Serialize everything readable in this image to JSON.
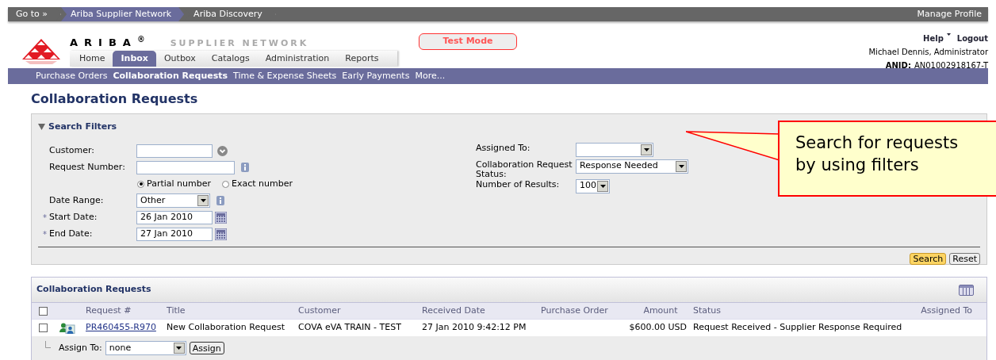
{
  "top_bar": {
    "links": [
      {
        "label": "Go to »",
        "selected": false
      },
      {
        "label": "Ariba Supplier Network",
        "selected": true
      },
      {
        "label": "Ariba Discovery",
        "selected": false
      }
    ],
    "right_link": "Manage Profile"
  },
  "header": {
    "brand": "ARIBA$^{®}$",
    "product": "SUPPLIER NETWORK",
    "mode": "Test Mode",
    "help": "Help",
    "logout": "Logout",
    "user": "Michael Dennis, Administrator",
    "anid_label": "ANID:",
    "anid": "AN01002918167-T",
    "tabs": [
      {
        "label": "Home",
        "selected": false
      },
      {
        "label": "Inbox",
        "selected": true
      },
      {
        "label": "Outbox",
        "selected": false
      },
      {
        "label": "Catalogs",
        "selected": false
      },
      {
        "label": "Administration",
        "selected": false
      },
      {
        "label": "Reports",
        "selected": false
      }
    ]
  },
  "subnav": [
    {
      "label": "Purchase Orders",
      "selected": false
    },
    {
      "label": "Collaboration Requests",
      "selected": true
    },
    {
      "label": "Time & Expense Sheets",
      "selected": false
    },
    {
      "label": "Early Payments",
      "selected": false
    },
    {
      "label": "More...",
      "selected": false
    }
  ],
  "page_title": "Collaboration Requests",
  "search_filters": {
    "title": "Search Filters",
    "expanded": true,
    "left": [
      {
        "kind": "lookup",
        "label": "Customer:"
      },
      {
        "kind": "number",
        "label": "Request Number:"
      },
      {
        "kind": "radio",
        "options": [
          {
            "label": "Partial number",
            "selected": true
          },
          {
            "label": "Exact number",
            "selected": false
          }
        ]
      },
      {
        "kind": "range",
        "label": "Date Range:",
        "value": "Other"
      },
      {
        "kind": "date",
        "marker": "*",
        "label": "Start Date:",
        "value": "26 Jan 2010"
      },
      {
        "kind": "date",
        "marker": "*",
        "label": "End Date:",
        "value": "27 Jan 2010"
      }
    ],
    "right": [
      {
        "kind": "select",
        "label": "Assigned To:"
      },
      {
        "kind": "select",
        "label": "Collaboration Request Status:",
        "value": "Response Needed"
      },
      {
        "kind": "select",
        "label": "Number of Results:",
        "value": "100"
      }
    ],
    "buttons": [
      {
        "label": "Search",
        "primary": true
      },
      {
        "label": "Reset",
        "primary": false
      }
    ]
  },
  "callout": "Search for requests by using filters",
  "table": {
    "title": "Collaboration Requests",
    "all_checked": false,
    "columns": [
      "Request #",
      "Title",
      "Customer",
      "Received Date",
      "Purchase Order",
      "Amount",
      "Status",
      "Assigned To"
    ],
    "rows": [
      {
        "checked": false,
        "request": "PR460455-R970",
        "title": "New Collaboration Request",
        "customer": "COVA eVA TRAIN - TEST",
        "received": "27 Jan 2010 9:42:12 PM",
        "amount": "$600.00 USD",
        "status": "Request Received - Supplier Response Required"
      }
    ],
    "assign": {
      "label": "Assign To:",
      "value": "none",
      "button": "Assign"
    }
  }
}
